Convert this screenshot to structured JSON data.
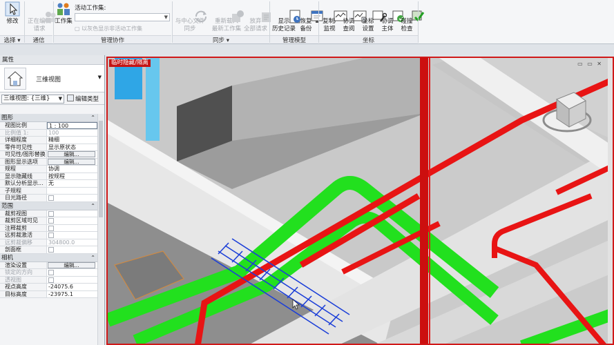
{
  "ribbon": {
    "modify": "修改",
    "select": "选择 ▾",
    "request": "正在编辑\n请求",
    "worksets_btn": "工作集",
    "active_workset_label": "活动工作集:",
    "gray_worksets": "以灰色显示非活动工作集",
    "sync": "与中心文件\n同步",
    "reload": "重新载入\n最新工作集",
    "relinquish": "放弃\n全部请求",
    "show_history": "显示\n历史记录",
    "restore_backup": "恢复\n备份",
    "copy_monitor": "复制/\n监视",
    "coord_review": "协调\n查阅",
    "coord_settings": "坐标\n设置",
    "coord_body": "协调\n主体",
    "interference": "碰撞\n检查",
    "groups": {
      "select": "选择 ▾",
      "comm": "通信",
      "manage_collab": "管理协作",
      "sync": "同步 ▾",
      "manage_model": "管理模型",
      "coords": "坐标"
    }
  },
  "properties": {
    "title": "属性",
    "type_name": "三维视图",
    "selector": "三维视图: {三维}",
    "edit_type": "编辑类型",
    "sections": {
      "graphics": "图形",
      "extents": "范围",
      "camera": "相机"
    },
    "rows_graphics": [
      {
        "k": "视图比例",
        "v": "1 : 100",
        "kind": "sel"
      },
      {
        "k": "比例值 1:",
        "v": "100",
        "kind": "gray"
      },
      {
        "k": "详细程度",
        "v": "精细",
        "kind": "text"
      },
      {
        "k": "零件可见性",
        "v": "显示原状态",
        "kind": "text"
      },
      {
        "k": "可见性/图形替换",
        "v": "编辑...",
        "kind": "btn"
      },
      {
        "k": "图形显示选项",
        "v": "编辑...",
        "kind": "btn"
      },
      {
        "k": "规程",
        "v": "协调",
        "kind": "text"
      },
      {
        "k": "显示隐藏线",
        "v": "按规程",
        "kind": "text"
      },
      {
        "k": "默认分析显示...",
        "v": "无",
        "kind": "text"
      },
      {
        "k": "子规程",
        "v": "",
        "kind": "text"
      },
      {
        "k": "日光路径",
        "v": "",
        "kind": "chk"
      }
    ],
    "rows_extents": [
      {
        "k": "裁剪视图",
        "v": "",
        "kind": "chk"
      },
      {
        "k": "裁剪区域可见",
        "v": "",
        "kind": "chk"
      },
      {
        "k": "注释裁剪",
        "v": "",
        "kind": "chk"
      },
      {
        "k": "远剪裁激活",
        "v": "",
        "kind": "chk"
      },
      {
        "k": "远剪裁偏移",
        "v": "304800.0",
        "kind": "gray"
      },
      {
        "k": "剖面框",
        "v": "",
        "kind": "chk"
      }
    ],
    "rows_camera": [
      {
        "k": "渲染设置",
        "v": "编辑...",
        "kind": "btn"
      },
      {
        "k": "锁定的方向",
        "v": "",
        "kind": "chkgray"
      },
      {
        "k": "透视图",
        "v": "",
        "kind": "chkgray"
      },
      {
        "k": "视点高度",
        "v": "-24075.6",
        "kind": "text"
      },
      {
        "k": "目标高度",
        "v": "-23975.1",
        "kind": "text"
      }
    ]
  },
  "viewport": {
    "banner": "临时隐藏/隔离",
    "controls": "▭ ▭ ✕"
  },
  "colors": {
    "pipe_green": "#22e01e",
    "pipe_red": "#e81414",
    "duct_blue": "#1c3fd8",
    "slab_gray": "#bdbdbd",
    "isolation_border": "#d01818"
  }
}
